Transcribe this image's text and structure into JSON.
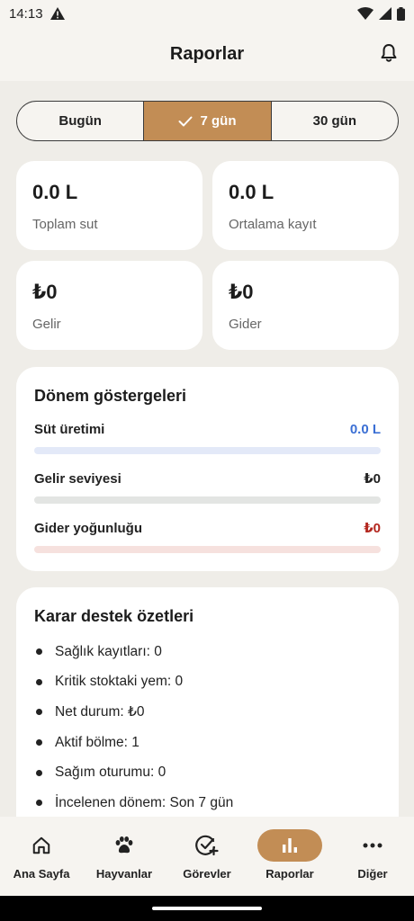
{
  "status_bar": {
    "time": "14:13"
  },
  "header": {
    "title": "Raporlar"
  },
  "period_selector": {
    "options": [
      {
        "label": "Bugün"
      },
      {
        "label": "7 gün"
      },
      {
        "label": "30 gün"
      }
    ],
    "selected": "7 gün"
  },
  "stats": [
    {
      "value": "0.0 L",
      "label": "Toplam sut"
    },
    {
      "value": "0.0 L",
      "label": "Ortalama kayıt"
    },
    {
      "value": "₺0",
      "label": "Gelir"
    },
    {
      "value": "₺0",
      "label": "Gider"
    }
  ],
  "indicators": {
    "title": "Dönem göstergeleri",
    "items": [
      {
        "label": "Süt üretimi",
        "value": "0.0 L",
        "level": 0,
        "value_color": "#3b6fd4",
        "track_color": "#e3e9f8"
      },
      {
        "label": "Gelir seviyesi",
        "value": "₺0",
        "level": 0,
        "value_color": "#222222",
        "track_color": "#e3e5e3"
      },
      {
        "label": "Gider yoğunluğu",
        "value": "₺0",
        "level": 0,
        "value_color": "#b3261e",
        "track_color": "#f6e1de"
      }
    ]
  },
  "decision_summary": {
    "title": "Karar destek özetleri",
    "items": [
      "Sağlık kayıtları: 0",
      "Kritik stoktaki yem: 0",
      "Net durum: ₺0",
      "Aktif bölme: 1",
      "Sağım oturumu: 0",
      "İncelenen dönem: Son 7 gün"
    ]
  },
  "bottom_nav": {
    "items": [
      {
        "label": "Ana Sayfa",
        "icon": "home-icon"
      },
      {
        "label": "Hayvanlar",
        "icon": "paw-icon"
      },
      {
        "label": "Görevler",
        "icon": "task-check-icon"
      },
      {
        "label": "Raporlar",
        "icon": "bar-chart-icon"
      },
      {
        "label": "Diğer",
        "icon": "more-icon"
      }
    ],
    "active": "Raporlar"
  },
  "colors": {
    "accent": "#c28d55",
    "background": "#efede8"
  }
}
